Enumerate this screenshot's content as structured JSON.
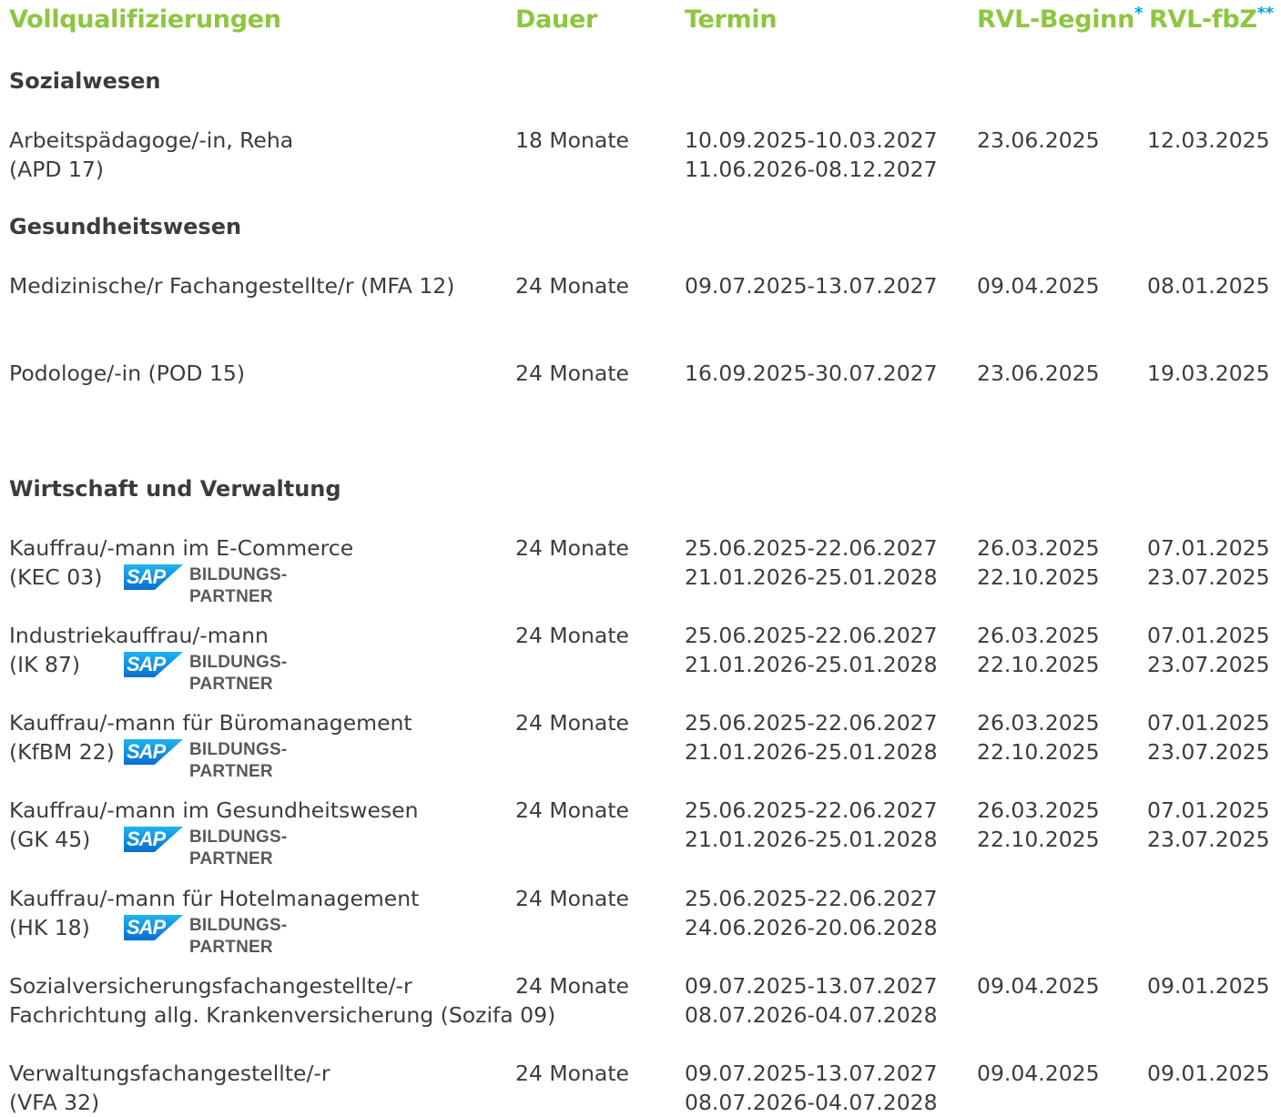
{
  "header": {
    "qualification": "Vollqualifizierungen",
    "duration": "Dauer",
    "date": "Termin",
    "rvl_start": "RVL-Beginn",
    "rvl_start_mark": "*",
    "rvl_fbz": "RVL-fbZ",
    "rvl_fbz_mark": "**"
  },
  "sap_label": {
    "logo": "SAP",
    "line1": "BILDUNGS-",
    "line2": "PARTNER"
  },
  "sections": [
    {
      "title": "Sozialwesen"
    },
    {
      "title": "Gesundheitswesen"
    },
    {
      "title": "Wirtschaft und Verwaltung"
    }
  ],
  "rows": [
    {
      "name1": "Arbeitspädagoge/-in, Reha",
      "name2": "(APD 17)",
      "duration": "18 Monate",
      "dates": [
        "10.09.2025-10.03.2027",
        "11.06.2026-08.12.2027"
      ],
      "rvl": [
        "23.06.2025"
      ],
      "fbz": [
        "12.03.2025"
      ]
    },
    {
      "name1": "Medizinische/r Fachangestellte/r (MFA 12)",
      "duration": "24 Monate",
      "dates": [
        "09.07.2025-13.07.2027"
      ],
      "rvl": [
        "09.04.2025"
      ],
      "fbz": [
        "08.01.2025"
      ]
    },
    {
      "name1": "Podologe/-in (POD 15)",
      "duration": "24 Monate",
      "dates": [
        "16.09.2025-30.07.2027"
      ],
      "rvl": [
        "23.06.2025"
      ],
      "fbz": [
        "19.03.2025"
      ]
    },
    {
      "name1": "Kauffrau/-mann im E-Commerce",
      "code": "(KEC 03)",
      "duration": "24 Monate",
      "dates": [
        "25.06.2025-22.06.2027",
        "21.01.2026-25.01.2028"
      ],
      "rvl": [
        "26.03.2025",
        "22.10.2025"
      ],
      "fbz": [
        "07.01.2025",
        "23.07.2025"
      ]
    },
    {
      "name1": "Industriekauffrau/-mann",
      "code": "(IK 87)",
      "duration": "24 Monate",
      "dates": [
        "25.06.2025-22.06.2027",
        "21.01.2026-25.01.2028"
      ],
      "rvl": [
        "26.03.2025",
        "22.10.2025"
      ],
      "fbz": [
        "07.01.2025",
        "23.07.2025"
      ]
    },
    {
      "name1": "Kauffrau/-mann für Büromanagement",
      "code": "(KfBM 22)",
      "duration": "24 Monate",
      "dates": [
        "25.06.2025-22.06.2027",
        "21.01.2026-25.01.2028"
      ],
      "rvl": [
        "26.03.2025",
        "22.10.2025"
      ],
      "fbz": [
        "07.01.2025",
        "23.07.2025"
      ]
    },
    {
      "name1": "Kauffrau/-mann im Gesundheitswesen",
      "code": "(GK 45)",
      "duration": "24 Monate",
      "dates": [
        "25.06.2025-22.06.2027",
        "21.01.2026-25.01.2028"
      ],
      "rvl": [
        "26.03.2025",
        "22.10.2025"
      ],
      "fbz": [
        "07.01.2025",
        "23.07.2025"
      ]
    },
    {
      "name1": "Kauffrau/-mann für Hotelmanagement",
      "code": "(HK 18)",
      "duration": "24 Monate",
      "dates": [
        "25.06.2025-22.06.2027",
        "24.06.2026-20.06.2028"
      ],
      "rvl": [],
      "fbz": []
    },
    {
      "name1": "Sozialversicherungsfachangestellte/-r",
      "name2": "Fachrichtung allg. Krankenversicherung (Sozifa 09)",
      "duration": "24 Monate",
      "dates": [
        "09.07.2025-13.07.2027",
        "08.07.2026-04.07.2028"
      ],
      "rvl": [
        "09.04.2025"
      ],
      "fbz": [
        "09.01.2025"
      ]
    },
    {
      "name1": "Verwaltungsfachangestellte/-r",
      "name2": "(VFA 32)",
      "duration": "24 Monate",
      "dates": [
        "09.07.2025-13.07.2027",
        "08.07.2026-04.07.2028"
      ],
      "rvl": [
        "09.04.2025"
      ],
      "fbz": [
        "09.01.2025"
      ]
    }
  ]
}
